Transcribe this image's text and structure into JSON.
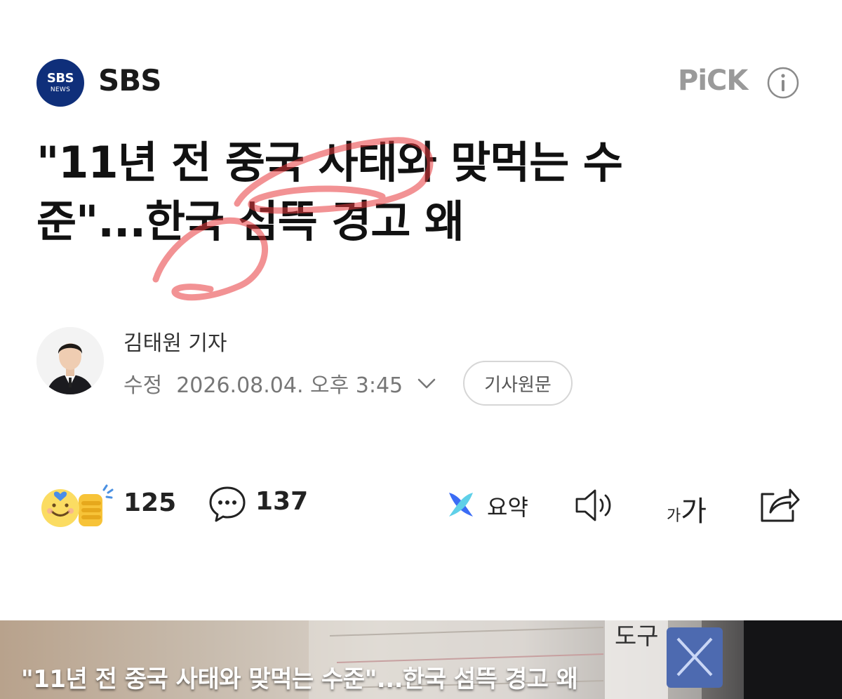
{
  "header": {
    "logo_line1": "SBS",
    "logo_line2": "NEWS",
    "press_name": "SBS",
    "pick_label": "PiCK"
  },
  "article": {
    "headline_line1": "\"11년 전 중국 사태와 맞먹는 수",
    "headline_line2": "준\"...한국 섬뜩 경고 왜",
    "reporter": "김태원 기자",
    "modified_label": "수정",
    "modified_datetime": "2026.08.04. 오후 3:45",
    "original_button": "기사원문"
  },
  "actions": {
    "reaction_count": "125",
    "comment_count": "137",
    "summary_label": "요약",
    "font_small": "가",
    "font_big": "가"
  },
  "photo": {
    "caption": "\"11년 전 중국 사태와 맞먹는 수준\"...한국 섬뜩 경고 왜",
    "overlay_text": "도구"
  },
  "colors": {
    "logo_bg": "#0f2f7a",
    "pick_gray": "#9a9a9a",
    "annotation_red": "#e8393c",
    "summary_blue": "#3b6cf5"
  },
  "icons": [
    "sbs-news-logo",
    "info-icon",
    "reporter-photo",
    "chevron-down-icon",
    "reaction-emoji-icon",
    "comment-icon",
    "summary-icon",
    "speaker-icon",
    "font-size-icon",
    "share-icon"
  ]
}
